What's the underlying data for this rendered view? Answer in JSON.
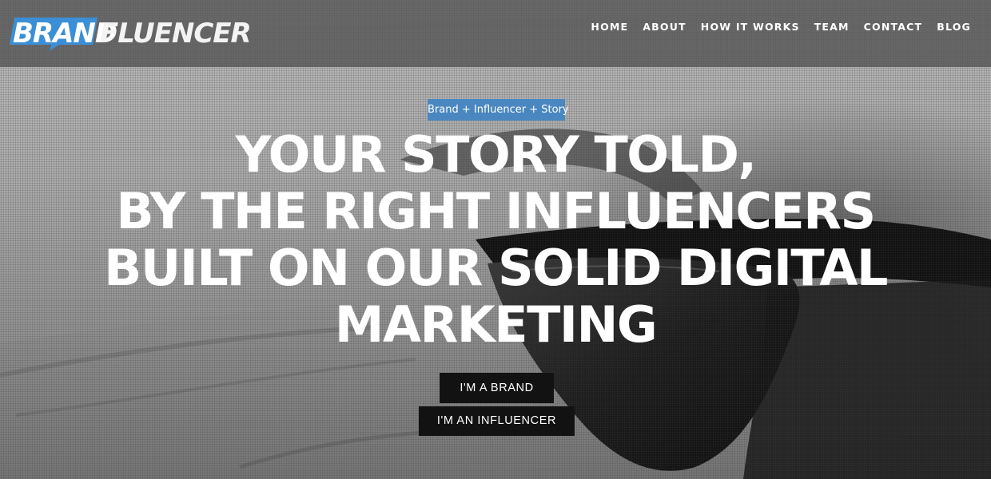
{
  "brand": {
    "logo_part1": "BRAND",
    "logo_part2": "FLUENCER",
    "logo_icon": "speech-bubble-icon",
    "accent_color": "#3a8fd6"
  },
  "nav": {
    "items": [
      {
        "label": "HOME"
      },
      {
        "label": "ABOUT"
      },
      {
        "label": "HOW IT WORKS"
      },
      {
        "label": "TEAM"
      },
      {
        "label": "CONTACT"
      },
      {
        "label": "BLOG"
      }
    ]
  },
  "hero": {
    "tagline": "Brand + Influencer + Story",
    "tagline_color": "#4a87c0",
    "headline_lines": [
      "YOUR STORY TOLD,",
      "BY THE RIGHT INFLUENCERS",
      "BUILT ON OUR SOLID DIGITAL",
      "MARKETING"
    ],
    "buttons": {
      "brand": "I'M A BRAND",
      "influencer": "I'M AN INFLUENCER"
    },
    "background_subject": "sunglasses-on-sand-photo"
  }
}
